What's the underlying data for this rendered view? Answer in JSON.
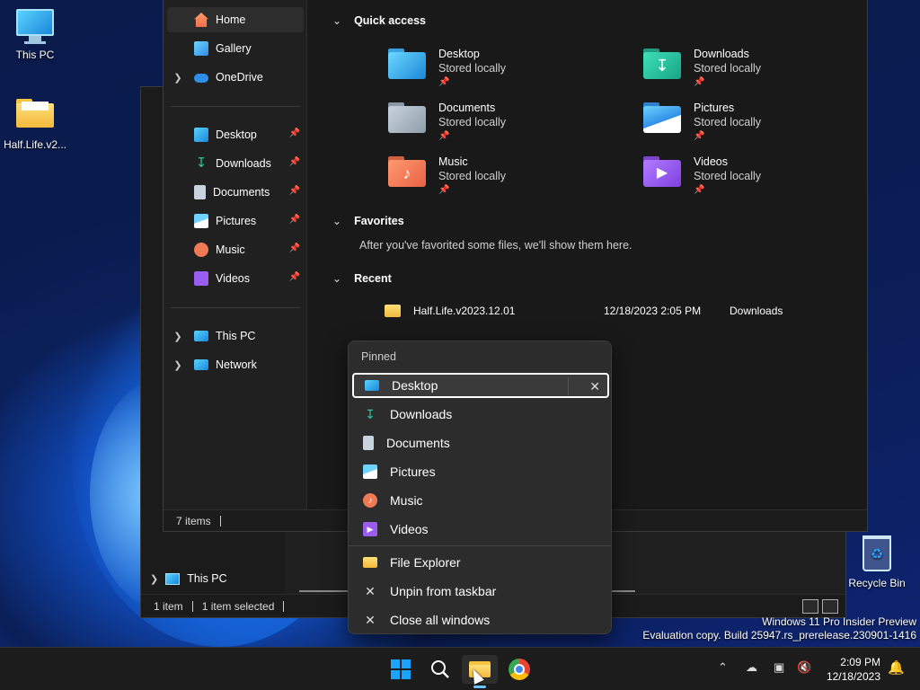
{
  "desktop": {
    "icons": [
      {
        "label": "This PC"
      },
      {
        "label": "Half.Life.v2..."
      }
    ],
    "recycle_bin": "Recycle Bin",
    "watermark_line1": "Windows 11 Pro Insider Preview",
    "watermark_line2": "Evaluation copy. Build 25947.rs_prerelease.230901-1416"
  },
  "back_window": {
    "nav_this_pc": "This PC",
    "status_items": "1 item",
    "status_selected": "1 item selected"
  },
  "explorer": {
    "nav": [
      {
        "label": "Home"
      },
      {
        "label": "Gallery"
      },
      {
        "label": "OneDrive"
      },
      {
        "label": "Desktop"
      },
      {
        "label": "Downloads"
      },
      {
        "label": "Documents"
      },
      {
        "label": "Pictures"
      },
      {
        "label": "Music"
      },
      {
        "label": "Videos"
      },
      {
        "label": "This PC"
      },
      {
        "label": "Network"
      }
    ],
    "quick_access": {
      "title": "Quick access",
      "items": [
        {
          "name": "Desktop",
          "sub": "Stored locally"
        },
        {
          "name": "Downloads",
          "sub": "Stored locally"
        },
        {
          "name": "Documents",
          "sub": "Stored locally"
        },
        {
          "name": "Pictures",
          "sub": "Stored locally"
        },
        {
          "name": "Music",
          "sub": "Stored locally"
        },
        {
          "name": "Videos",
          "sub": "Stored locally"
        }
      ]
    },
    "favorites": {
      "title": "Favorites",
      "empty_msg": "After you've favorited some files, we'll show them here."
    },
    "recent": {
      "title": "Recent",
      "items": [
        {
          "name": "Half.Life.v2023.12.01",
          "date": "12/18/2023 2:05 PM",
          "location": "Downloads"
        }
      ]
    },
    "status": "7 items"
  },
  "jump_list": {
    "header": "Pinned",
    "pinned": [
      {
        "label": "Desktop"
      },
      {
        "label": "Downloads"
      },
      {
        "label": "Documents"
      },
      {
        "label": "Pictures"
      },
      {
        "label": "Music"
      },
      {
        "label": "Videos"
      }
    ],
    "actions": [
      {
        "label": "File Explorer"
      },
      {
        "label": "Unpin from taskbar"
      },
      {
        "label": "Close all windows"
      }
    ]
  },
  "taskbar": {
    "time": "2:09 PM",
    "date": "12/18/2023"
  },
  "colors": {
    "accent": "#1aa3ff",
    "downloads_green": "#2ec4a0",
    "music_orange": "#f07a55",
    "videos_purple": "#9b5cf0",
    "pictures_blue": "#2f8fe8"
  }
}
